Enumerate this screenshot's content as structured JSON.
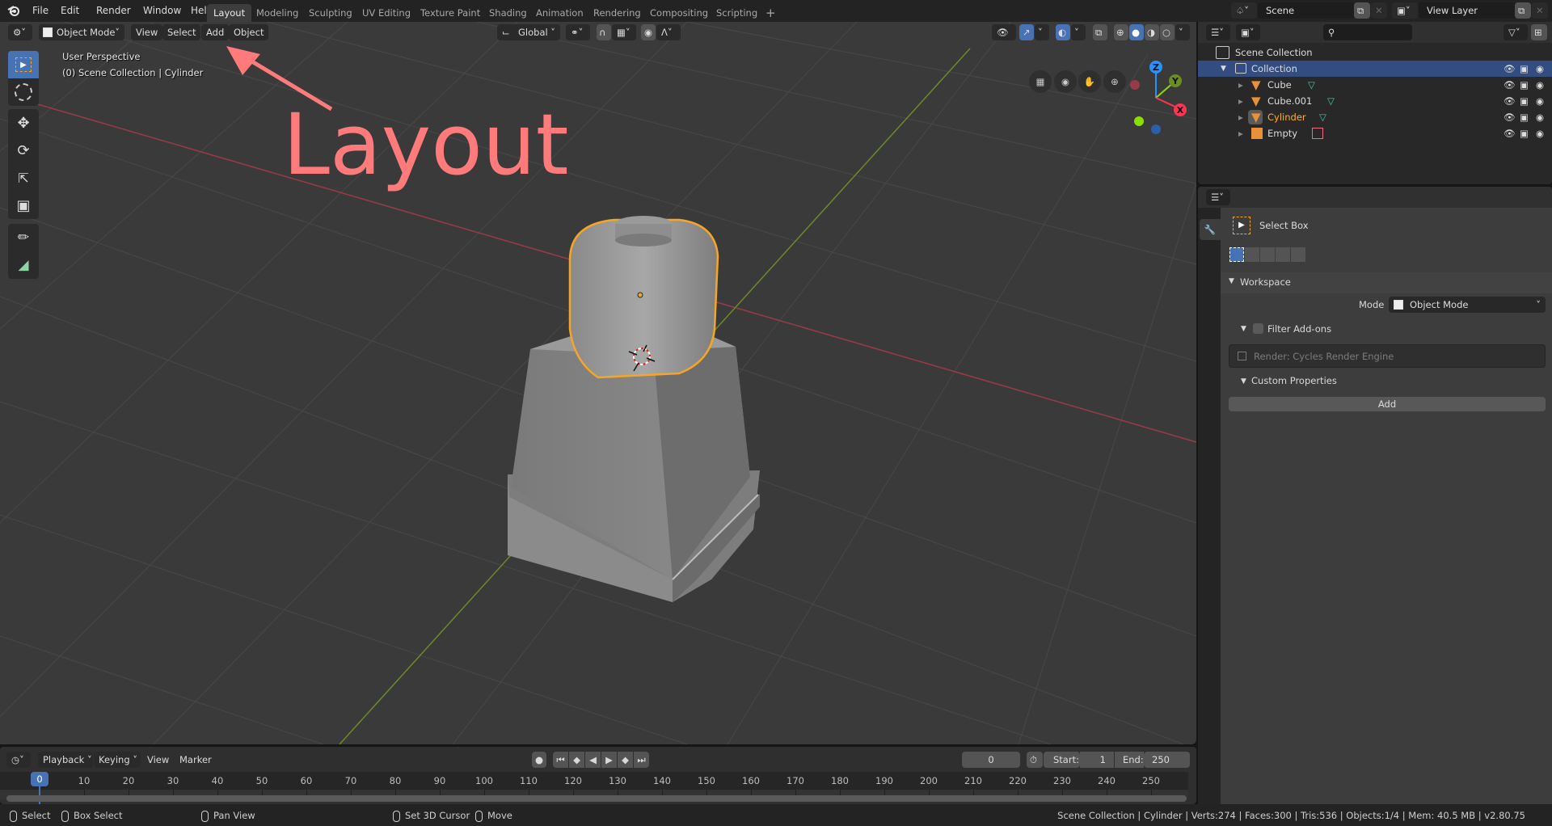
{
  "topbar": {
    "app_icon": "blender-logo-icon",
    "menus": [
      "File",
      "Edit",
      "Render",
      "Window",
      "Help"
    ],
    "workspaces": [
      "Layout",
      "Modeling",
      "Sculpting",
      "UV Editing",
      "Texture Paint",
      "Shading",
      "Animation",
      "Rendering",
      "Compositing",
      "Scripting"
    ],
    "active_workspace": "Layout",
    "add_workspace": "+",
    "scene_label": "Scene",
    "view_layer_label": "View Layer"
  },
  "viewport": {
    "mode": "Object Mode",
    "menus": [
      "View",
      "Select",
      "Add",
      "Object"
    ],
    "transform_orientation": "Global",
    "overlay_line1": "User Perspective",
    "overlay_line2": "(0) Scene Collection | Cylinder",
    "tools": [
      "select-box-icon",
      "cursor-icon",
      "move-icon",
      "rotate-icon",
      "scale-icon",
      "transform-icon",
      "annotate-icon",
      "measure-icon"
    ],
    "gizmo_axes": {
      "x": "X",
      "y": "Y",
      "z": "Z"
    },
    "axis_colors": {
      "x": "#ff3352",
      "y": "#8bdc00",
      "z": "#2890ff"
    }
  },
  "annotation": {
    "text": "Layout",
    "color": "#ff7b7b"
  },
  "outliner": {
    "root": "Scene Collection",
    "collection": "Collection",
    "items": [
      {
        "name": "Cube",
        "type": "mesh",
        "selected": false
      },
      {
        "name": "Cube.001",
        "type": "mesh",
        "selected": false
      },
      {
        "name": "Cylinder",
        "type": "mesh",
        "selected": true
      },
      {
        "name": "Empty",
        "type": "empty",
        "selected": false
      }
    ]
  },
  "properties": {
    "tool_name": "Select Box",
    "workspace_panel": "Workspace",
    "mode_label": "Mode",
    "mode_value": "Object Mode",
    "filter_addons": "Filter Add-ons",
    "addon_item": "Render: Cycles Render Engine",
    "custom_props": "Custom Properties",
    "add_button": "Add"
  },
  "timeline": {
    "menus": [
      "Playback",
      "Keying",
      "View",
      "Marker"
    ],
    "current_frame": "0",
    "start_label": "Start:",
    "start_value": "1",
    "end_label": "End:",
    "end_value": "250",
    "ticks": [
      "0",
      "10",
      "20",
      "30",
      "40",
      "50",
      "60",
      "70",
      "80",
      "90",
      "100",
      "110",
      "120",
      "130",
      "140",
      "150",
      "160",
      "170",
      "180",
      "190",
      "200",
      "210",
      "220",
      "230",
      "240",
      "250"
    ]
  },
  "statusbar": {
    "select": "Select",
    "box_select": "Box Select",
    "pan_view": "Pan View",
    "set_cursor": "Set 3D Cursor",
    "move": "Move",
    "stats": "Scene Collection | Cylinder | Verts:274 | Faces:300 | Tris:536 | Objects:1/4 | Mem: 40.5 MB | v2.80.75"
  }
}
